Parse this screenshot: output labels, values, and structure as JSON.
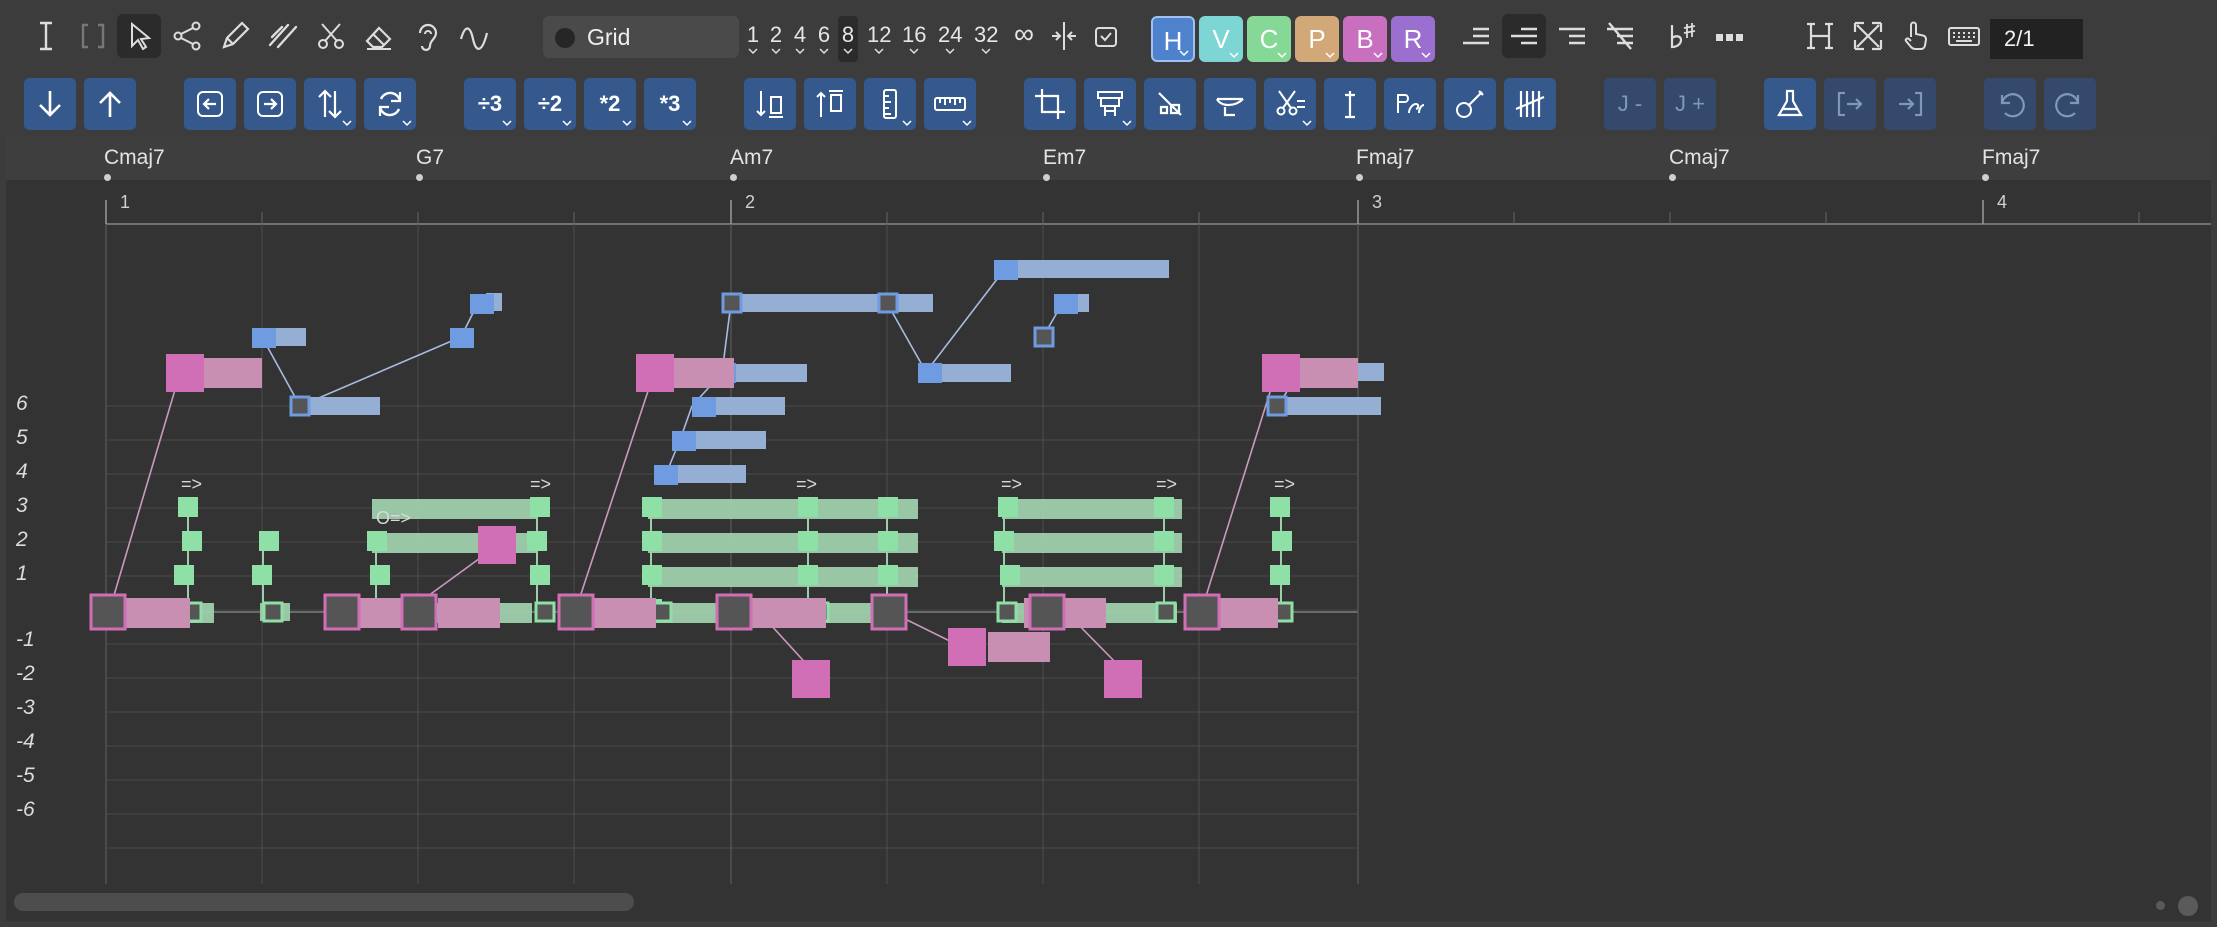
{
  "toolbar": {
    "grid_label": "Grid",
    "divisions": [
      "1",
      "2",
      "4",
      "6",
      "8",
      "12",
      "16",
      "24",
      "32",
      "∞"
    ],
    "active_division": "8",
    "voices": [
      {
        "label": "H",
        "color": "#4f82cc"
      },
      {
        "label": "V",
        "color": "#7ed6d4"
      },
      {
        "label": "C",
        "color": "#86d896"
      },
      {
        "label": "P",
        "color": "#d2a878"
      },
      {
        "label": "B",
        "color": "#c86fbf"
      },
      {
        "label": "R",
        "color": "#9b6fd0"
      }
    ],
    "counter": "2/1",
    "icons_row1": [
      "text-cursor-icon",
      "bracket-icon",
      "arrow-pointer-icon",
      "share-node-icon",
      "pencil-icon",
      "double-stroke-icon",
      "scissors-icon",
      "eraser-icon",
      "ear-icon",
      "wave-icon"
    ],
    "row2_text": {
      "div3": "÷3",
      "div2": "÷2",
      "mul2": "*2",
      "mul3": "*3",
      "jminus": "J -",
      "jplus": "J +"
    }
  },
  "chords": [
    {
      "name": "Cmaj7"
    },
    {
      "name": "G7"
    },
    {
      "name": "Am7"
    },
    {
      "name": "Em7"
    },
    {
      "name": "Fmaj7"
    },
    {
      "name": "Cmaj7"
    },
    {
      "name": "Fmaj7"
    }
  ],
  "bars": [
    "1",
    "2",
    "3",
    "4"
  ],
  "yaxis": [
    "6",
    "5",
    "4",
    "3",
    "2",
    "1",
    "-1",
    "-2",
    "-3",
    "-4",
    "-5",
    "-6"
  ],
  "annotations": {
    "arrow": "=>",
    "o_arrow": "O=>"
  },
  "colors": {
    "pink": "#d16fb6",
    "pink_light": "#c88fb2",
    "blue": "#6f9be0",
    "blue_light": "#95aed3",
    "green": "#8fe0a6",
    "green_light": "#9fcfac",
    "accent_blue": "#35598d"
  }
}
